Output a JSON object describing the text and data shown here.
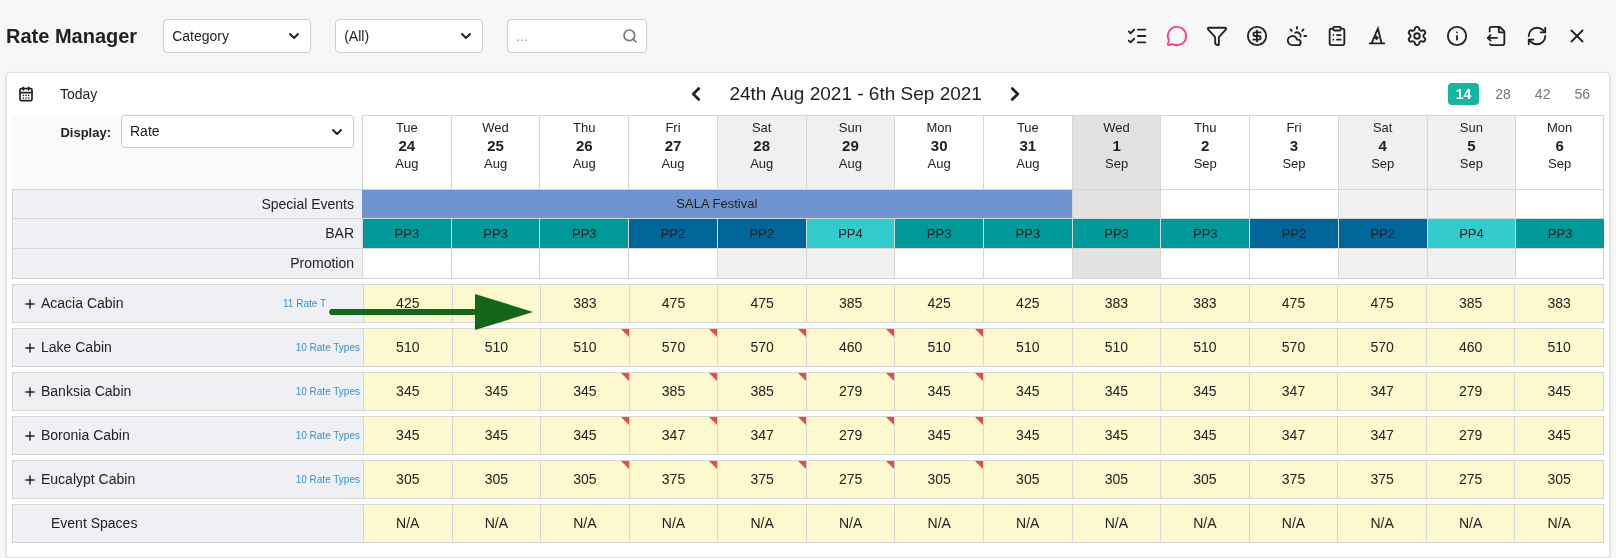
{
  "title": "Rate Manager",
  "filters": [
    {
      "value": "Category"
    },
    {
      "value": "(All)"
    }
  ],
  "search": {
    "placeholder": "..."
  },
  "today_button": "Today",
  "date_range": "24th Aug 2021 - 6th Sep 2021",
  "periods": [
    {
      "label": "14",
      "selected": true
    },
    {
      "label": "28",
      "selected": false
    },
    {
      "label": "42",
      "selected": false
    },
    {
      "label": "56",
      "selected": false
    }
  ],
  "display": {
    "label": "Display:",
    "value": "Rate"
  },
  "days": [
    {
      "weekday": "Tue",
      "day": "24",
      "month": "Aug",
      "weekend": false,
      "current": false,
      "event": true
    },
    {
      "weekday": "Wed",
      "day": "25",
      "month": "Aug",
      "weekend": false,
      "current": false,
      "event": true
    },
    {
      "weekday": "Thu",
      "day": "26",
      "month": "Aug",
      "weekend": false,
      "current": false,
      "event": true
    },
    {
      "weekday": "Fri",
      "day": "27",
      "month": "Aug",
      "weekend": false,
      "current": false,
      "event": true
    },
    {
      "weekday": "Sat",
      "day": "28",
      "month": "Aug",
      "weekend": true,
      "current": false,
      "event": true
    },
    {
      "weekday": "Sun",
      "day": "29",
      "month": "Aug",
      "weekend": true,
      "current": false,
      "event": true
    },
    {
      "weekday": "Mon",
      "day": "30",
      "month": "Aug",
      "weekend": false,
      "current": false,
      "event": true
    },
    {
      "weekday": "Tue",
      "day": "31",
      "month": "Aug",
      "weekend": false,
      "current": false,
      "event": true
    },
    {
      "weekday": "Wed",
      "day": "1",
      "month": "Sep",
      "weekend": false,
      "current": true,
      "event": false
    },
    {
      "weekday": "Thu",
      "day": "2",
      "month": "Sep",
      "weekend": false,
      "current": false,
      "event": false
    },
    {
      "weekday": "Fri",
      "day": "3",
      "month": "Sep",
      "weekend": false,
      "current": false,
      "event": false
    },
    {
      "weekday": "Sat",
      "day": "4",
      "month": "Sep",
      "weekend": true,
      "current": false,
      "event": false
    },
    {
      "weekday": "Sun",
      "day": "5",
      "month": "Sep",
      "weekend": true,
      "current": false,
      "event": false
    },
    {
      "weekday": "Mon",
      "day": "6",
      "month": "Sep",
      "weekend": false,
      "current": false,
      "event": false
    }
  ],
  "special_events": {
    "label": "Special Events",
    "event": "SALA Festival"
  },
  "bar": {
    "label": "BAR",
    "cells": [
      {
        "text": "PP3",
        "color": "#009999"
      },
      {
        "text": "PP3",
        "color": "#009999"
      },
      {
        "text": "PP3",
        "color": "#009999"
      },
      {
        "text": "PP2",
        "color": "#006699"
      },
      {
        "text": "PP2",
        "color": "#006699"
      },
      {
        "text": "PP4",
        "color": "#33cccc"
      },
      {
        "text": "PP3",
        "color": "#009999"
      },
      {
        "text": "PP3",
        "color": "#009999"
      },
      {
        "text": "PP3",
        "color": "#009999"
      },
      {
        "text": "PP3",
        "color": "#009999"
      },
      {
        "text": "PP2",
        "color": "#006699"
      },
      {
        "text": "PP2",
        "color": "#006699"
      },
      {
        "text": "PP4",
        "color": "#33cccc"
      },
      {
        "text": "PP3",
        "color": "#009999"
      }
    ]
  },
  "promotion": {
    "label": "Promotion"
  },
  "rooms": [
    {
      "name": "Acacia Cabin",
      "rate_types": "11 Rate T",
      "expandable": true,
      "rates": [
        {
          "value": "425",
          "flagged": false
        },
        {
          "flagged": false
        },
        {
          "value": "383",
          "flagged": false
        },
        {
          "value": "475",
          "flagged": false
        },
        {
          "value": "475",
          "flagged": false
        },
        {
          "value": "385",
          "flagged": false
        },
        {
          "value": "425",
          "flagged": false
        },
        {
          "value": "425",
          "flagged": false
        },
        {
          "value": "383",
          "flagged": false
        },
        {
          "value": "383",
          "flagged": false
        },
        {
          "value": "475",
          "flagged": false
        },
        {
          "value": "475",
          "flagged": false
        },
        {
          "value": "385",
          "flagged": false
        },
        {
          "value": "383",
          "flagged": false
        }
      ]
    },
    {
      "name": "Lake Cabin",
      "rate_types": "10 Rate Types",
      "expandable": true,
      "rates": [
        {
          "value": "510",
          "flagged": false
        },
        {
          "value": "510",
          "flagged": false
        },
        {
          "value": "510",
          "flagged": true
        },
        {
          "value": "570",
          "flagged": true
        },
        {
          "value": "570",
          "flagged": true
        },
        {
          "value": "460",
          "flagged": true
        },
        {
          "value": "510",
          "flagged": true
        },
        {
          "value": "510",
          "flagged": false
        },
        {
          "value": "510",
          "flagged": false
        },
        {
          "value": "510",
          "flagged": false
        },
        {
          "value": "570",
          "flagged": false
        },
        {
          "value": "570",
          "flagged": false
        },
        {
          "value": "460",
          "flagged": false
        },
        {
          "value": "510",
          "flagged": false
        }
      ]
    },
    {
      "name": "Banksia Cabin",
      "rate_types": "10 Rate Types",
      "expandable": true,
      "rates": [
        {
          "value": "345",
          "flagged": false
        },
        {
          "value": "345",
          "flagged": false
        },
        {
          "value": "345",
          "flagged": true
        },
        {
          "value": "385",
          "flagged": true
        },
        {
          "value": "385",
          "flagged": true
        },
        {
          "value": "279",
          "flagged": true
        },
        {
          "value": "345",
          "flagged": true
        },
        {
          "value": "345",
          "flagged": false
        },
        {
          "value": "345",
          "flagged": false
        },
        {
          "value": "345",
          "flagged": false
        },
        {
          "value": "347",
          "flagged": false
        },
        {
          "value": "347",
          "flagged": false
        },
        {
          "value": "279",
          "flagged": false
        },
        {
          "value": "345",
          "flagged": false
        }
      ]
    },
    {
      "name": "Boronia Cabin",
      "rate_types": "10 Rate Types",
      "expandable": true,
      "rates": [
        {
          "value": "345",
          "flagged": false
        },
        {
          "value": "345",
          "flagged": false
        },
        {
          "value": "345",
          "flagged": true
        },
        {
          "value": "347",
          "flagged": true
        },
        {
          "value": "347",
          "flagged": true
        },
        {
          "value": "279",
          "flagged": true
        },
        {
          "value": "345",
          "flagged": true
        },
        {
          "value": "345",
          "flagged": false
        },
        {
          "value": "345",
          "flagged": false
        },
        {
          "value": "345",
          "flagged": false
        },
        {
          "value": "347",
          "flagged": false
        },
        {
          "value": "347",
          "flagged": false
        },
        {
          "value": "279",
          "flagged": false
        },
        {
          "value": "345",
          "flagged": false
        }
      ]
    },
    {
      "name": "Eucalypt Cabin",
      "rate_types": "10 Rate Types",
      "expandable": true,
      "rates": [
        {
          "value": "305",
          "flagged": false
        },
        {
          "value": "305",
          "flagged": false
        },
        {
          "value": "305",
          "flagged": true
        },
        {
          "value": "375",
          "flagged": true
        },
        {
          "value": "375",
          "flagged": true
        },
        {
          "value": "275",
          "flagged": true
        },
        {
          "value": "305",
          "flagged": true
        },
        {
          "value": "305",
          "flagged": false
        },
        {
          "value": "305",
          "flagged": false
        },
        {
          "value": "305",
          "flagged": false
        },
        {
          "value": "375",
          "flagged": false
        },
        {
          "value": "375",
          "flagged": false
        },
        {
          "value": "275",
          "flagged": false
        },
        {
          "value": "305",
          "flagged": false
        }
      ]
    },
    {
      "name": "Event Spaces",
      "expandable": false,
      "rates": [
        {
          "value": "N/A",
          "flagged": false
        },
        {
          "value": "N/A",
          "flagged": false
        },
        {
          "value": "N/A",
          "flagged": false
        },
        {
          "value": "N/A",
          "flagged": false
        },
        {
          "value": "N/A",
          "flagged": false
        },
        {
          "value": "N/A",
          "flagged": false
        },
        {
          "value": "N/A",
          "flagged": false
        },
        {
          "value": "N/A",
          "flagged": false
        },
        {
          "value": "N/A",
          "flagged": false
        },
        {
          "value": "N/A",
          "flagged": false
        },
        {
          "value": "N/A",
          "flagged": false
        },
        {
          "value": "N/A",
          "flagged": false
        },
        {
          "value": "N/A",
          "flagged": false
        },
        {
          "value": "N/A",
          "flagged": false
        }
      ]
    }
  ]
}
